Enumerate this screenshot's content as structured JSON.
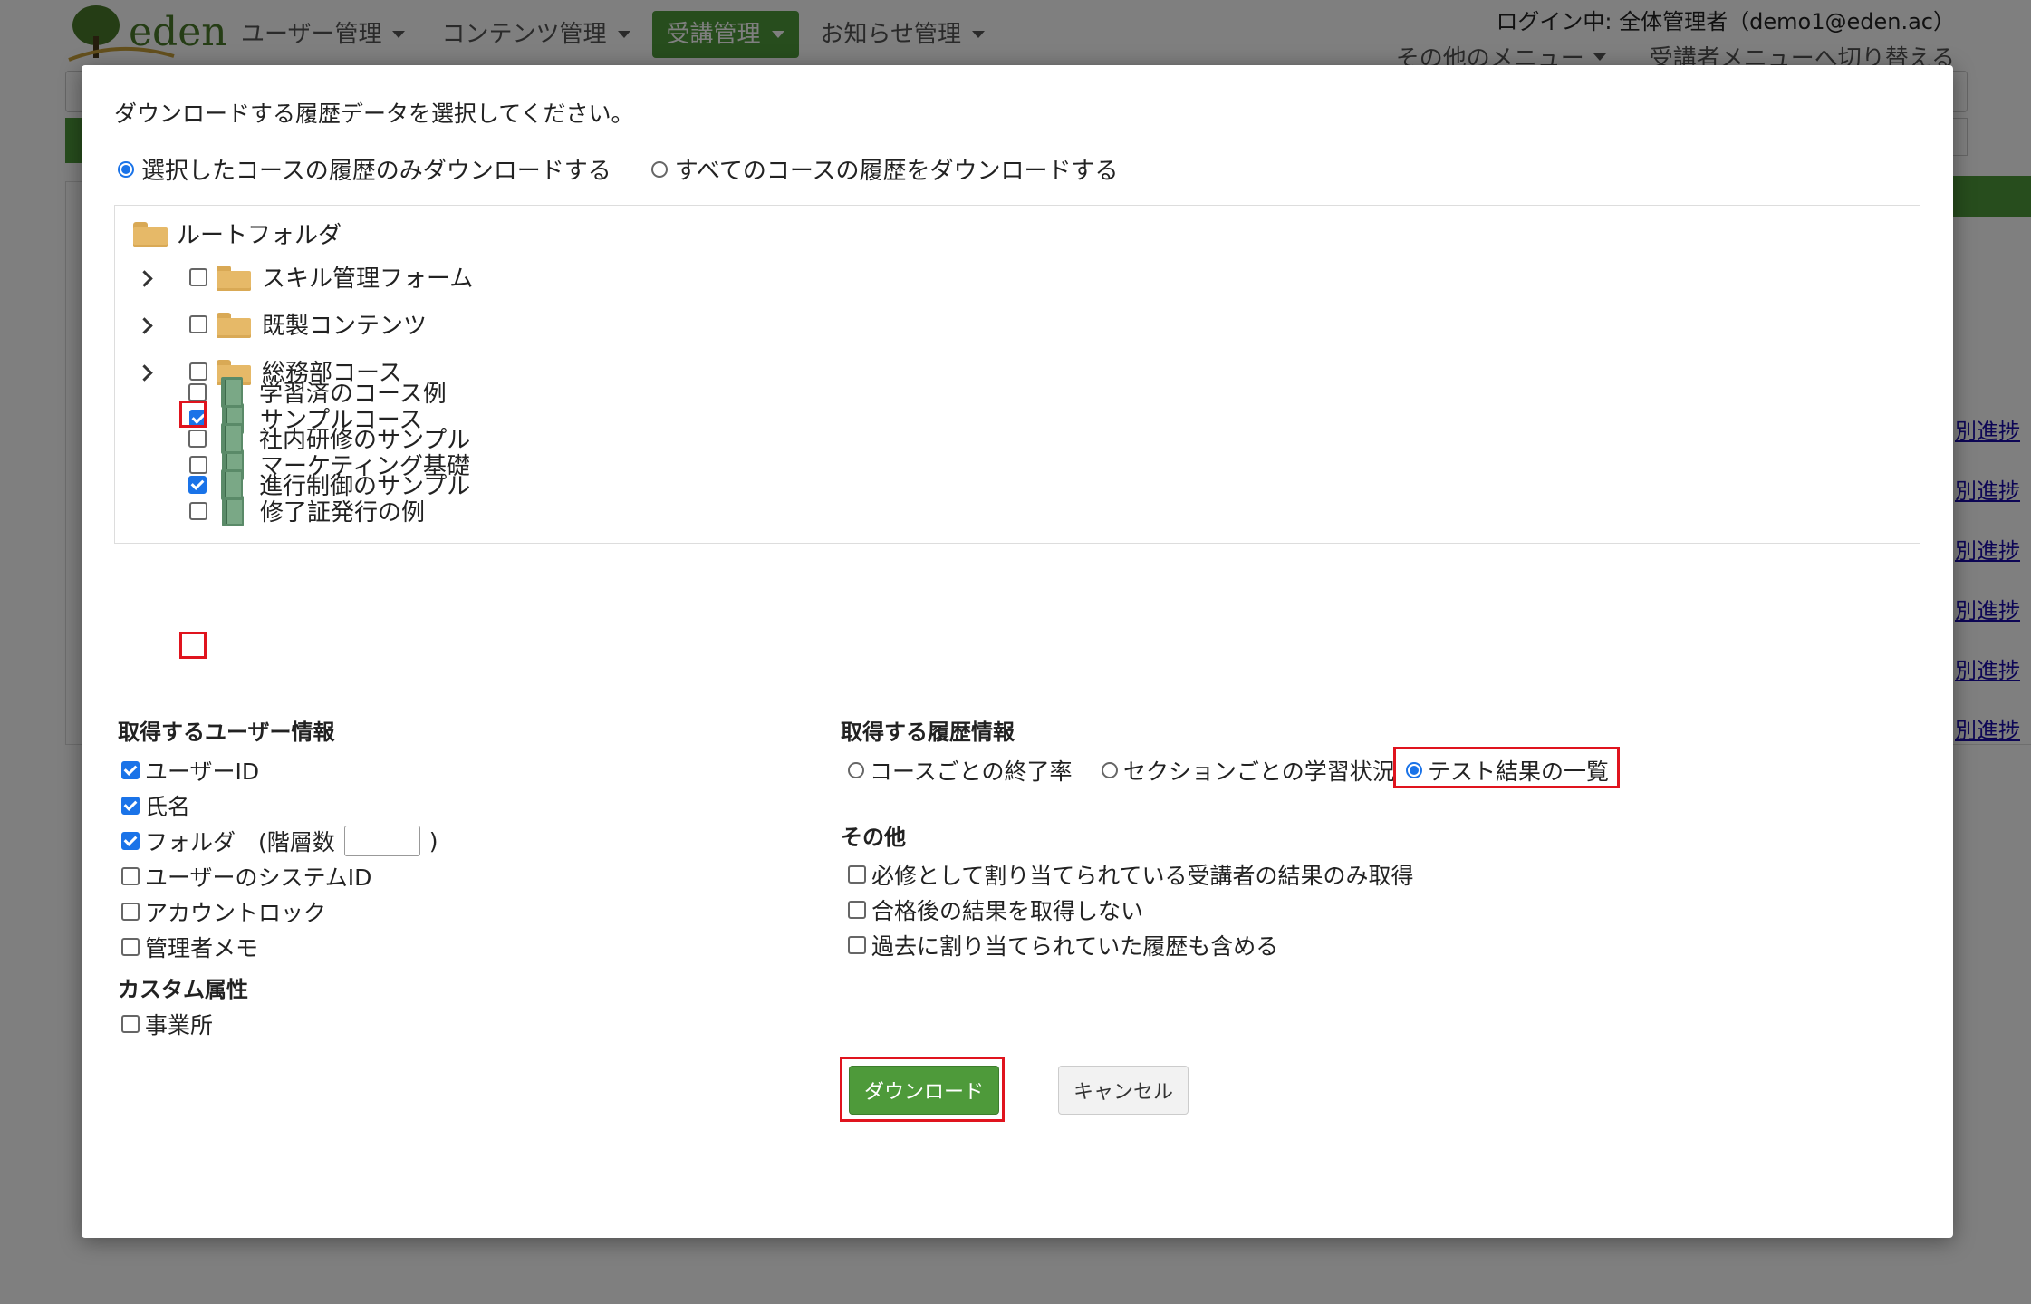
{
  "app": {
    "logo_text": "eden",
    "nav": [
      {
        "label": "ユーザー管理"
      },
      {
        "label": "コンテンツ管理"
      },
      {
        "label": "受講管理"
      },
      {
        "label": "お知らせ管理"
      }
    ],
    "login_text": "ログイン中: 全体管理者（demo1@eden.ac）",
    "other_menu": "その他のメニュー",
    "switch_menu": "受講者メニューへ切り替える",
    "bg_link": "別進捗",
    "accent": "#4e9a3a"
  },
  "modal": {
    "intro": "ダウンロードする履歴データを選択してください。",
    "scope_options": [
      {
        "label": "選択したコースの履歴のみダウンロードする",
        "selected": true
      },
      {
        "label": "すべてのコースの履歴をダウンロードする",
        "selected": false
      }
    ],
    "tree": {
      "root": "ルートフォルダ",
      "items": [
        {
          "label": "スキル管理フォーム",
          "type": "folder",
          "checked": false,
          "icon": "folder-icon"
        },
        {
          "label": "既製コンテンツ",
          "type": "folder",
          "checked": false,
          "icon": "folder-icon"
        },
        {
          "label": "総務部コース",
          "type": "folder",
          "checked": false,
          "icon": "folder-icon"
        },
        {
          "label": "サンプルコース",
          "type": "course",
          "checked": true,
          "icon": "book-icon"
        },
        {
          "label": "マーケティング基礎",
          "type": "course",
          "checked": false,
          "icon": "book-icon"
        },
        {
          "label": "修了証発行の例",
          "type": "course",
          "checked": false,
          "icon": "book-icon"
        },
        {
          "label": "学習済のコース例",
          "type": "course",
          "checked": false,
          "icon": "book-icon"
        },
        {
          "label": "社内研修のサンプル",
          "type": "course",
          "checked": false,
          "icon": "book-icon"
        },
        {
          "label": "進行制御のサンプル",
          "type": "course",
          "checked": true,
          "icon": "book-icon"
        }
      ]
    },
    "user_info": {
      "title": "取得するユーザー情報",
      "items": [
        {
          "label": "ユーザーID",
          "checked": true
        },
        {
          "label": "氏名",
          "checked": true
        },
        {
          "label": "フォルダ　(階層数",
          "suffix": ")",
          "checked": true,
          "input_value": ""
        },
        {
          "label": "ユーザーのシステムID",
          "checked": false
        },
        {
          "label": "アカウントロック",
          "checked": false
        },
        {
          "label": "管理者メモ",
          "checked": false
        }
      ]
    },
    "custom_attr": {
      "title": "カスタム属性",
      "items": [
        {
          "label": "事業所",
          "checked": false
        }
      ]
    },
    "history_info": {
      "title": "取得する履歴情報",
      "options": [
        {
          "label": "コースごとの終了率",
          "selected": false
        },
        {
          "label": "セクションごとの学習状況",
          "selected": false
        },
        {
          "label": "テスト結果の一覧",
          "selected": true
        }
      ]
    },
    "other": {
      "title": "その他",
      "items": [
        {
          "label": "必修として割り当てられている受講者の結果のみ取得",
          "checked": false
        },
        {
          "label": "合格後の結果を取得しない",
          "checked": false
        },
        {
          "label": "過去に割り当てられていた履歴も含める",
          "checked": false
        }
      ]
    },
    "download_label": "ダウンロード",
    "cancel_label": "キャンセル"
  }
}
